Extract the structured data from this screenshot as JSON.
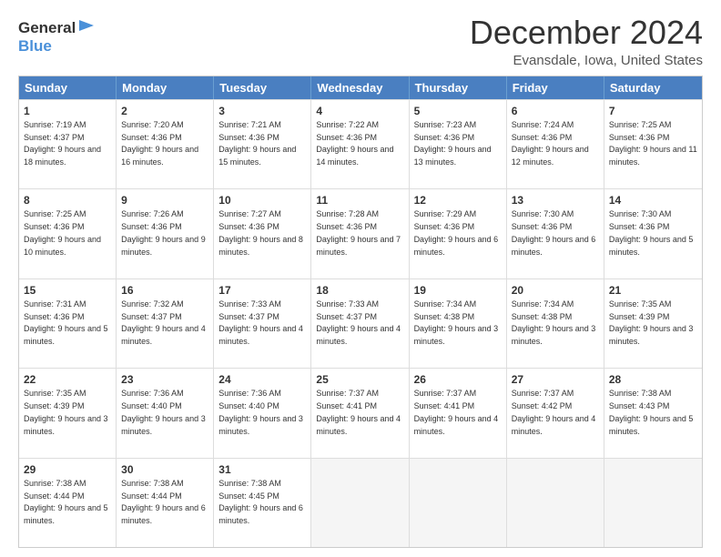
{
  "logo": {
    "line1": "General",
    "line2": "Blue"
  },
  "title": "December 2024",
  "location": "Evansdale, Iowa, United States",
  "days_of_week": [
    "Sunday",
    "Monday",
    "Tuesday",
    "Wednesday",
    "Thursday",
    "Friday",
    "Saturday"
  ],
  "weeks": [
    [
      {
        "day": "1",
        "sunrise": "7:19 AM",
        "sunset": "4:37 PM",
        "daylight": "9 hours and 18 minutes."
      },
      {
        "day": "2",
        "sunrise": "7:20 AM",
        "sunset": "4:36 PM",
        "daylight": "9 hours and 16 minutes."
      },
      {
        "day": "3",
        "sunrise": "7:21 AM",
        "sunset": "4:36 PM",
        "daylight": "9 hours and 15 minutes."
      },
      {
        "day": "4",
        "sunrise": "7:22 AM",
        "sunset": "4:36 PM",
        "daylight": "9 hours and 14 minutes."
      },
      {
        "day": "5",
        "sunrise": "7:23 AM",
        "sunset": "4:36 PM",
        "daylight": "9 hours and 13 minutes."
      },
      {
        "day": "6",
        "sunrise": "7:24 AM",
        "sunset": "4:36 PM",
        "daylight": "9 hours and 12 minutes."
      },
      {
        "day": "7",
        "sunrise": "7:25 AM",
        "sunset": "4:36 PM",
        "daylight": "9 hours and 11 minutes."
      }
    ],
    [
      {
        "day": "8",
        "sunrise": "7:25 AM",
        "sunset": "4:36 PM",
        "daylight": "9 hours and 10 minutes."
      },
      {
        "day": "9",
        "sunrise": "7:26 AM",
        "sunset": "4:36 PM",
        "daylight": "9 hours and 9 minutes."
      },
      {
        "day": "10",
        "sunrise": "7:27 AM",
        "sunset": "4:36 PM",
        "daylight": "9 hours and 8 minutes."
      },
      {
        "day": "11",
        "sunrise": "7:28 AM",
        "sunset": "4:36 PM",
        "daylight": "9 hours and 7 minutes."
      },
      {
        "day": "12",
        "sunrise": "7:29 AM",
        "sunset": "4:36 PM",
        "daylight": "9 hours and 6 minutes."
      },
      {
        "day": "13",
        "sunrise": "7:30 AM",
        "sunset": "4:36 PM",
        "daylight": "9 hours and 6 minutes."
      },
      {
        "day": "14",
        "sunrise": "7:30 AM",
        "sunset": "4:36 PM",
        "daylight": "9 hours and 5 minutes."
      }
    ],
    [
      {
        "day": "15",
        "sunrise": "7:31 AM",
        "sunset": "4:36 PM",
        "daylight": "9 hours and 5 minutes."
      },
      {
        "day": "16",
        "sunrise": "7:32 AM",
        "sunset": "4:37 PM",
        "daylight": "9 hours and 4 minutes."
      },
      {
        "day": "17",
        "sunrise": "7:33 AM",
        "sunset": "4:37 PM",
        "daylight": "9 hours and 4 minutes."
      },
      {
        "day": "18",
        "sunrise": "7:33 AM",
        "sunset": "4:37 PM",
        "daylight": "9 hours and 4 minutes."
      },
      {
        "day": "19",
        "sunrise": "7:34 AM",
        "sunset": "4:38 PM",
        "daylight": "9 hours and 3 minutes."
      },
      {
        "day": "20",
        "sunrise": "7:34 AM",
        "sunset": "4:38 PM",
        "daylight": "9 hours and 3 minutes."
      },
      {
        "day": "21",
        "sunrise": "7:35 AM",
        "sunset": "4:39 PM",
        "daylight": "9 hours and 3 minutes."
      }
    ],
    [
      {
        "day": "22",
        "sunrise": "7:35 AM",
        "sunset": "4:39 PM",
        "daylight": "9 hours and 3 minutes."
      },
      {
        "day": "23",
        "sunrise": "7:36 AM",
        "sunset": "4:40 PM",
        "daylight": "9 hours and 3 minutes."
      },
      {
        "day": "24",
        "sunrise": "7:36 AM",
        "sunset": "4:40 PM",
        "daylight": "9 hours and 3 minutes."
      },
      {
        "day": "25",
        "sunrise": "7:37 AM",
        "sunset": "4:41 PM",
        "daylight": "9 hours and 4 minutes."
      },
      {
        "day": "26",
        "sunrise": "7:37 AM",
        "sunset": "4:41 PM",
        "daylight": "9 hours and 4 minutes."
      },
      {
        "day": "27",
        "sunrise": "7:37 AM",
        "sunset": "4:42 PM",
        "daylight": "9 hours and 4 minutes."
      },
      {
        "day": "28",
        "sunrise": "7:38 AM",
        "sunset": "4:43 PM",
        "daylight": "9 hours and 5 minutes."
      }
    ],
    [
      {
        "day": "29",
        "sunrise": "7:38 AM",
        "sunset": "4:44 PM",
        "daylight": "9 hours and 5 minutes."
      },
      {
        "day": "30",
        "sunrise": "7:38 AM",
        "sunset": "4:44 PM",
        "daylight": "9 hours and 6 minutes."
      },
      {
        "day": "31",
        "sunrise": "7:38 AM",
        "sunset": "4:45 PM",
        "daylight": "9 hours and 6 minutes."
      },
      null,
      null,
      null,
      null
    ]
  ]
}
